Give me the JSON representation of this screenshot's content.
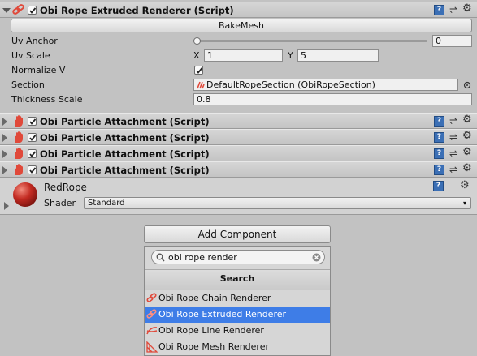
{
  "component_extruded": {
    "title": "Obi Rope Extruded Renderer (Script)",
    "enabled": true,
    "bake_button": "BakeMesh",
    "fields": {
      "uv_anchor": {
        "label": "Uv Anchor",
        "value": "0",
        "slider_fraction": 0.0
      },
      "uv_scale": {
        "label": "Uv Scale",
        "x_label": "X",
        "x_value": "1",
        "y_label": "Y",
        "y_value": "5"
      },
      "normalize_v": {
        "label": "Normalize V",
        "checked": true
      },
      "section": {
        "label": "Section",
        "value": "DefaultRopeSection (ObiRopeSection)"
      },
      "thickness_scale": {
        "label": "Thickness Scale",
        "value": "0.8"
      }
    }
  },
  "attachments": [
    {
      "title": "Obi Particle Attachment (Script)",
      "enabled": true
    },
    {
      "title": "Obi Particle Attachment (Script)",
      "enabled": true
    },
    {
      "title": "Obi Particle Attachment (Script)",
      "enabled": true
    },
    {
      "title": "Obi Particle Attachment (Script)",
      "enabled": true
    }
  ],
  "material": {
    "name": "RedRope",
    "shader_label": "Shader",
    "shader_value": "Standard"
  },
  "add_component": {
    "button_label": "Add Component",
    "search_value": "obi rope render",
    "section_header": "Search",
    "items": [
      {
        "label": "Obi Rope Chain Renderer",
        "icon": "chain-link-icon",
        "selected": false
      },
      {
        "label": "Obi Rope Extruded Renderer",
        "icon": "chain-link-icon",
        "selected": true
      },
      {
        "label": "Obi Rope Line Renderer",
        "icon": "line-renderer-icon",
        "selected": false
      },
      {
        "label": "Obi Rope Mesh Renderer",
        "icon": "mesh-renderer-icon",
        "selected": false
      }
    ]
  },
  "colors": {
    "selection": "#3e7de7",
    "rope_icon": "#e0493a",
    "book_icon": "#3b6fb5"
  }
}
